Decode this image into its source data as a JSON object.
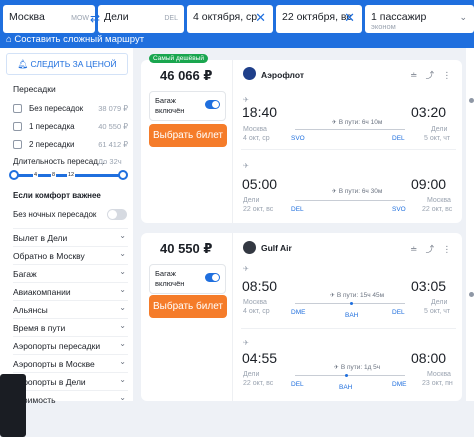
{
  "search": {
    "from": "Москва",
    "from_code": "MOW",
    "to": "Дели",
    "to_code": "DEL",
    "depart": "4 октября, ср",
    "return": "22 октября, вс",
    "passengers": "1 пассажир",
    "class": "эконом",
    "complex_route": "Составить сложный маршрут"
  },
  "filters": {
    "track_price": "СЛЕДИТЬ ЗА ЦЕНОЙ",
    "stops_title": "Пересадки",
    "stops": [
      {
        "label": "Без пересадок",
        "price": "38 079 ₽"
      },
      {
        "label": "1 пересадка",
        "price": "40 550 ₽"
      },
      {
        "label": "2 пересадки",
        "price": "61 412 ₽"
      }
    ],
    "layover_label": "Длительность пересад...",
    "layover_max": "До 32ч",
    "ticks": [
      "4",
      "8",
      "12"
    ],
    "comfort_title": "Если комфорт важнее",
    "no_night": "Без ночных пересадок",
    "sections": [
      "Вылет в Дели",
      "Обратно в Москву",
      "Багаж",
      "Авиакомпании",
      "Альянсы",
      "Время в пути",
      "Аэропорты пересадки",
      "Аэропорты в Москве",
      "Аэропорты в Дели",
      "Стоимость"
    ]
  },
  "bag_text": "Багаж включён",
  "buy_label": "Выбрать билет",
  "cheapest_badge": "Самый дешёвый",
  "icons": {
    "card_icons": "≐ ⤴ ⋮",
    "plane": "✈"
  },
  "cards": [
    {
      "price": "46 066 ₽",
      "airline": "Аэрофлот",
      "logo_color": "#1f3f8a",
      "legs": [
        {
          "dep_time": "18:40",
          "arr_time": "03:20",
          "dep_city": "Москва",
          "arr_city": "Дели",
          "dep_date": "4 окт, ср",
          "arr_date": "5 окт, чт",
          "dur": "В пути: 6ч 10м",
          "dep_code": "SVO",
          "arr_code": "DEL",
          "stop_code": ""
        },
        {
          "dep_time": "05:00",
          "arr_time": "09:00",
          "dep_city": "Дели",
          "arr_city": "Москва",
          "dep_date": "22 окт, вс",
          "arr_date": "22 окт, вс",
          "dur": "В пути: 6ч 30м",
          "dep_code": "DEL",
          "arr_code": "SVO",
          "stop_code": ""
        }
      ]
    },
    {
      "price": "40 550 ₽",
      "airline": "Gulf Air",
      "logo_color": "#333842",
      "legs": [
        {
          "dep_time": "08:50",
          "arr_time": "03:05",
          "dep_city": "Москва",
          "arr_city": "Дели",
          "dep_date": "4 окт, ср",
          "arr_date": "5 окт, чт",
          "dur": "В пути: 15ч 45м",
          "dep_code": "DME",
          "arr_code": "DEL",
          "stop_code": "BAH"
        },
        {
          "dep_time": "04:55",
          "arr_time": "08:00",
          "dep_city": "Дели",
          "arr_city": "Москва",
          "dep_date": "22 окт, вс",
          "arr_date": "23 окт, пн",
          "dur": "В пути: 1д 5ч",
          "dep_code": "DEL",
          "arr_code": "DME",
          "stop_code": "BAH"
        }
      ]
    }
  ],
  "colors": {
    "brand": "#1f6fde",
    "buy": "#f57c2a",
    "badge": "#1aa64f"
  }
}
